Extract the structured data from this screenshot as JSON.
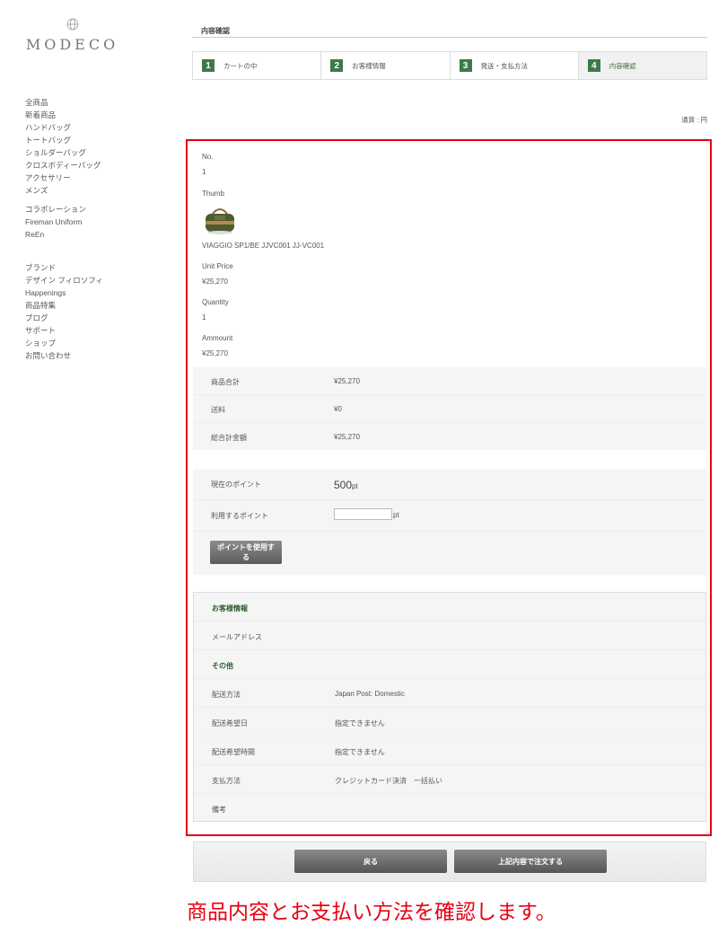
{
  "logo": {
    "text": "MODECO"
  },
  "sidebar": {
    "group1": [
      "全商品",
      "新着商品",
      "ハンドバッグ",
      "トートバッグ",
      "ショルダーバッグ",
      "クロスボディーバッグ",
      "アクセサリー",
      "メンズ"
    ],
    "group2": [
      "コラボレーション",
      "Fireman Uniform",
      "ReEn"
    ],
    "group3": [
      "ブランド",
      "デザイン フィロソフィ",
      "Happenings",
      "商品特集",
      "ブログ",
      "サポート",
      "ショップ",
      "お問い合わせ"
    ]
  },
  "header": {
    "title": "内容確認"
  },
  "steps": [
    {
      "num": "1",
      "label": "カートの中"
    },
    {
      "num": "2",
      "label": "お客様情報"
    },
    {
      "num": "3",
      "label": "発送・支払方法"
    },
    {
      "num": "4",
      "label": "内容確認"
    }
  ],
  "currency": "通貨 : 円",
  "item": {
    "no_label": "No.",
    "no_value": "1",
    "thumb_label": "Thumb",
    "product_name": "VIAGGIO SP1/BE JJVC001 JJ-VC001",
    "unit_price_label": "Unit Price",
    "unit_price_value": "¥25,270",
    "quantity_label": "Quantity",
    "quantity_value": "1",
    "amount_label": "Ammount",
    "amount_value": "¥25,270"
  },
  "totals": {
    "subtotal_label": "商品合計",
    "subtotal_value": "¥25,270",
    "shipping_label": "送料",
    "shipping_value": "¥0",
    "grand_total_label": "総合計金額",
    "grand_total_value": "¥25,270"
  },
  "points": {
    "current_label": "現在のポイント",
    "current_value": "500",
    "current_unit": "pt",
    "use_label": "利用するポイント",
    "use_input_value": "",
    "use_unit": "pt",
    "use_button": "ポイントを使用する"
  },
  "customer": {
    "section_title": "お客様情報",
    "email_label": "メールアドレス",
    "other_title": "その他",
    "ship_method_label": "配送方法",
    "ship_method_value": "Japan Post: Domestic",
    "ship_date_label": "配送希望日",
    "ship_date_value": "指定できません",
    "ship_time_label": "配送希望時間",
    "ship_time_value": "指定できません",
    "payment_label": "支払方法",
    "payment_value": "クレジットカード決済　一括払い",
    "notes_label": "備考"
  },
  "actions": {
    "back": "戻る",
    "order": "上記内容で注文する"
  },
  "caption": "商品内容とお支払い方法を確認します。",
  "colors": {
    "accent_green": "#3d7a4a",
    "highlight_red": "#e60012"
  }
}
